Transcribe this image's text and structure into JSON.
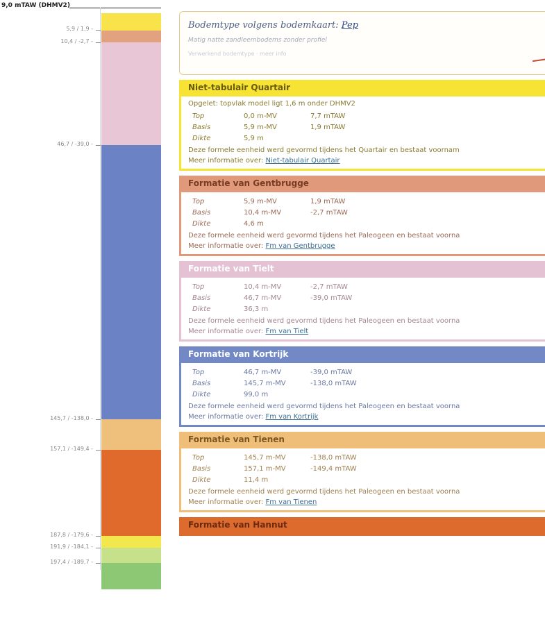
{
  "profile": {
    "surface_label": "9,0 mTAW (DHMV2)",
    "layers": [
      {
        "name": "Niet-tabulair Quartair",
        "color": "#f8e44a"
      },
      {
        "name": "Formatie van Gentbrugge",
        "color": "#e2a17f"
      },
      {
        "name": "Formatie van Tielt",
        "color": "#e8c6d6"
      },
      {
        "name": "Formatie van Kortrijk",
        "color": "#6b82c5"
      },
      {
        "name": "Formatie van Tienen",
        "color": "#efc07c"
      },
      {
        "name": "Formatie van Hannut",
        "color": "#df6a2c"
      },
      {
        "name": "yellow-layer",
        "color": "#f3e74e"
      },
      {
        "name": "light-green-layer",
        "color": "#c7e18a"
      },
      {
        "name": "green-layer",
        "color": "#8dc874"
      }
    ],
    "depth_labels": [
      "5,9 / 1,9 -",
      "10,4 / -2,7 -",
      "46,7 / -39,0 -",
      "145,7 / -138,0 -",
      "157,1 / -149,4 -",
      "187,8 / -179,6 -",
      "191,9 / -184,1 -",
      "197,4 / -189,7 -"
    ]
  },
  "soil": {
    "title_prefix": "Bodemtype volgens bodemkaart:",
    "title_link": "Pep",
    "subtitle": "Matig natte zandleembodems zonder profiel",
    "extra": "Verwerkend bodemtype · meer info"
  },
  "formations": [
    {
      "name": "Niet-tabulair Quartair",
      "color": "#f7e334",
      "header_text": "#6a5a10",
      "text": "#8a7a30",
      "note": "Opgelet: topvlak model ligt 1,6 m onder DHMV2",
      "rows": [
        {
          "label": "Top",
          "v1": "0,0 m-MV",
          "v2": "7,7 mTAW"
        },
        {
          "label": "Basis",
          "v1": "5,9 m-MV",
          "v2": "1,9 mTAW"
        },
        {
          "label": "Dikte",
          "v1": "5,9 m",
          "v2": ""
        }
      ],
      "desc": "Deze formele eenheid werd gevormd tijdens het Quartair en bestaat voornam",
      "more_prefix": "Meer informatie over:",
      "more_link": "Niet-tabulair Quartair"
    },
    {
      "name": "Formatie van Gentbrugge",
      "color": "#e0997a",
      "header_text": "#7a3a22",
      "text": "#9a6a55",
      "note": "",
      "rows": [
        {
          "label": "Top",
          "v1": "5,9 m-MV",
          "v2": "1,9 mTAW"
        },
        {
          "label": "Basis",
          "v1": "10,4 m-MV",
          "v2": "-2,7 mTAW"
        },
        {
          "label": "Dikte",
          "v1": "4,6 m",
          "v2": ""
        }
      ],
      "desc": "Deze formele eenheid werd gevormd tijdens het Paleogeen en bestaat voorna",
      "more_prefix": "Meer informatie over:",
      "more_link": "Fm van Gentbrugge"
    },
    {
      "name": "Formatie van Tielt",
      "color": "#e5c2d3",
      "header_text": "#ffffff",
      "text": "#a48594",
      "note": "",
      "rows": [
        {
          "label": "Top",
          "v1": "10,4 m-MV",
          "v2": "-2,7 mTAW"
        },
        {
          "label": "Basis",
          "v1": "46,7 m-MV",
          "v2": "-39,0 mTAW"
        },
        {
          "label": "Dikte",
          "v1": "36,3 m",
          "v2": ""
        }
      ],
      "desc": "Deze formele eenheid werd gevormd tijdens het Paleogeen en bestaat voorna",
      "more_prefix": "Meer informatie over:",
      "more_link": "Fm van Tielt"
    },
    {
      "name": "Formatie van Kortrijk",
      "color": "#7289c5",
      "header_text": "#ffffff",
      "text": "#6a78a0",
      "note": "",
      "rows": [
        {
          "label": "Top",
          "v1": "46,7 m-MV",
          "v2": "-39,0 mTAW"
        },
        {
          "label": "Basis",
          "v1": "145,7 m-MV",
          "v2": "-138,0 mTAW"
        },
        {
          "label": "Dikte",
          "v1": "99,0 m",
          "v2": ""
        }
      ],
      "desc": "Deze formele eenheid werd gevormd tijdens het Paleogeen en bestaat voorna",
      "more_prefix": "Meer informatie over:",
      "more_link": "Fm van Kortrijk"
    },
    {
      "name": "Formatie van Tienen",
      "color": "#efbf7a",
      "header_text": "#7a5520",
      "text": "#a08050",
      "note": "",
      "rows": [
        {
          "label": "Top",
          "v1": "145,7 m-MV",
          "v2": "-138,0 mTAW"
        },
        {
          "label": "Basis",
          "v1": "157,1 m-MV",
          "v2": "-149,4 mTAW"
        },
        {
          "label": "Dikte",
          "v1": "11,4 m",
          "v2": ""
        }
      ],
      "desc": "Deze formele eenheid werd gevormd tijdens het Paleogeen en bestaat voorna",
      "more_prefix": "Meer informatie over:",
      "more_link": "Fm van Tienen"
    },
    {
      "name": "Formatie van Hannut",
      "color": "#de6b2e",
      "header_text": "#6a2a10",
      "text": "#a06040",
      "note": "",
      "rows": [],
      "desc": "",
      "more_prefix": "",
      "more_link": ""
    }
  ]
}
